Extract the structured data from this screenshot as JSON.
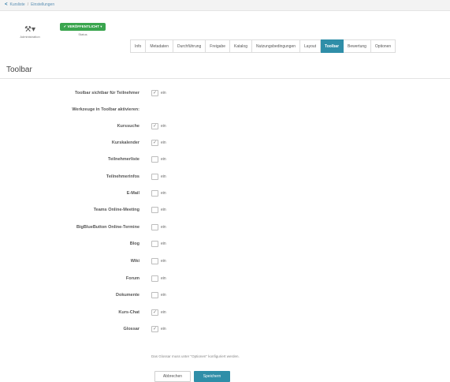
{
  "breadcrumb": {
    "back": "<",
    "items": [
      "Kursliste",
      "Einstellungen"
    ]
  },
  "toolbar": {
    "admin_icon": "wrench-icon",
    "admin_label": "Administration",
    "status_badge": "✔ VERÖFFENTLICHT ▾",
    "status_label": "Status"
  },
  "tabs": [
    {
      "label": "Info",
      "active": false
    },
    {
      "label": "Metadaten",
      "active": false
    },
    {
      "label": "Durchführung",
      "active": false
    },
    {
      "label": "Freigabe",
      "active": false
    },
    {
      "label": "Katalog",
      "active": false
    },
    {
      "label": "Nutzungsbedingungen",
      "active": false
    },
    {
      "label": "Layout",
      "active": false
    },
    {
      "label": "Toolbar",
      "active": true
    },
    {
      "label": "Bewertung",
      "active": false
    },
    {
      "label": "Optionen",
      "active": false
    }
  ],
  "section_title": "Toolbar",
  "form": {
    "rows": [
      {
        "label": "Toolbar sichtbar für Teilnehmer",
        "checkbox": true,
        "checked": true,
        "option": "ein"
      },
      {
        "label": "Werkzeuge in Toolbar aktivieren:",
        "checkbox": false
      },
      {
        "label": "Kurssuche",
        "checkbox": true,
        "checked": true,
        "option": "ein"
      },
      {
        "label": "Kurskalender",
        "checkbox": true,
        "checked": true,
        "option": "ein"
      },
      {
        "label": "Teilnehmerliste",
        "checkbox": true,
        "checked": false,
        "option": "ein"
      },
      {
        "label": "Teilnehmerinfos",
        "checkbox": true,
        "checked": false,
        "option": "ein"
      },
      {
        "label": "E-Mail",
        "checkbox": true,
        "checked": false,
        "option": "ein"
      },
      {
        "label": "Teams Online-Meeting",
        "checkbox": true,
        "checked": false,
        "option": "ein"
      },
      {
        "label": "BigBlueButton Online-Termine",
        "checkbox": true,
        "checked": false,
        "option": "ein"
      },
      {
        "label": "Blog",
        "checkbox": true,
        "checked": false,
        "option": "ein"
      },
      {
        "label": "Wiki",
        "checkbox": true,
        "checked": false,
        "option": "ein"
      },
      {
        "label": "Forum",
        "checkbox": true,
        "checked": false,
        "option": "ein"
      },
      {
        "label": "Dokumente",
        "checkbox": true,
        "checked": false,
        "option": "ein"
      },
      {
        "label": "Kurs-Chat",
        "checkbox": true,
        "checked": true,
        "option": "ein"
      },
      {
        "label": "Glossar",
        "checkbox": true,
        "checked": true,
        "option": "ein"
      }
    ],
    "glossar_hint": "Das Glossar muss unter \"Optionen\" konfiguriert werden.",
    "cancel_label": "Abbrechen",
    "save_label": "Speichern"
  },
  "colors": {
    "accent": "#2f8ea8",
    "status_green": "#3aa54e"
  }
}
